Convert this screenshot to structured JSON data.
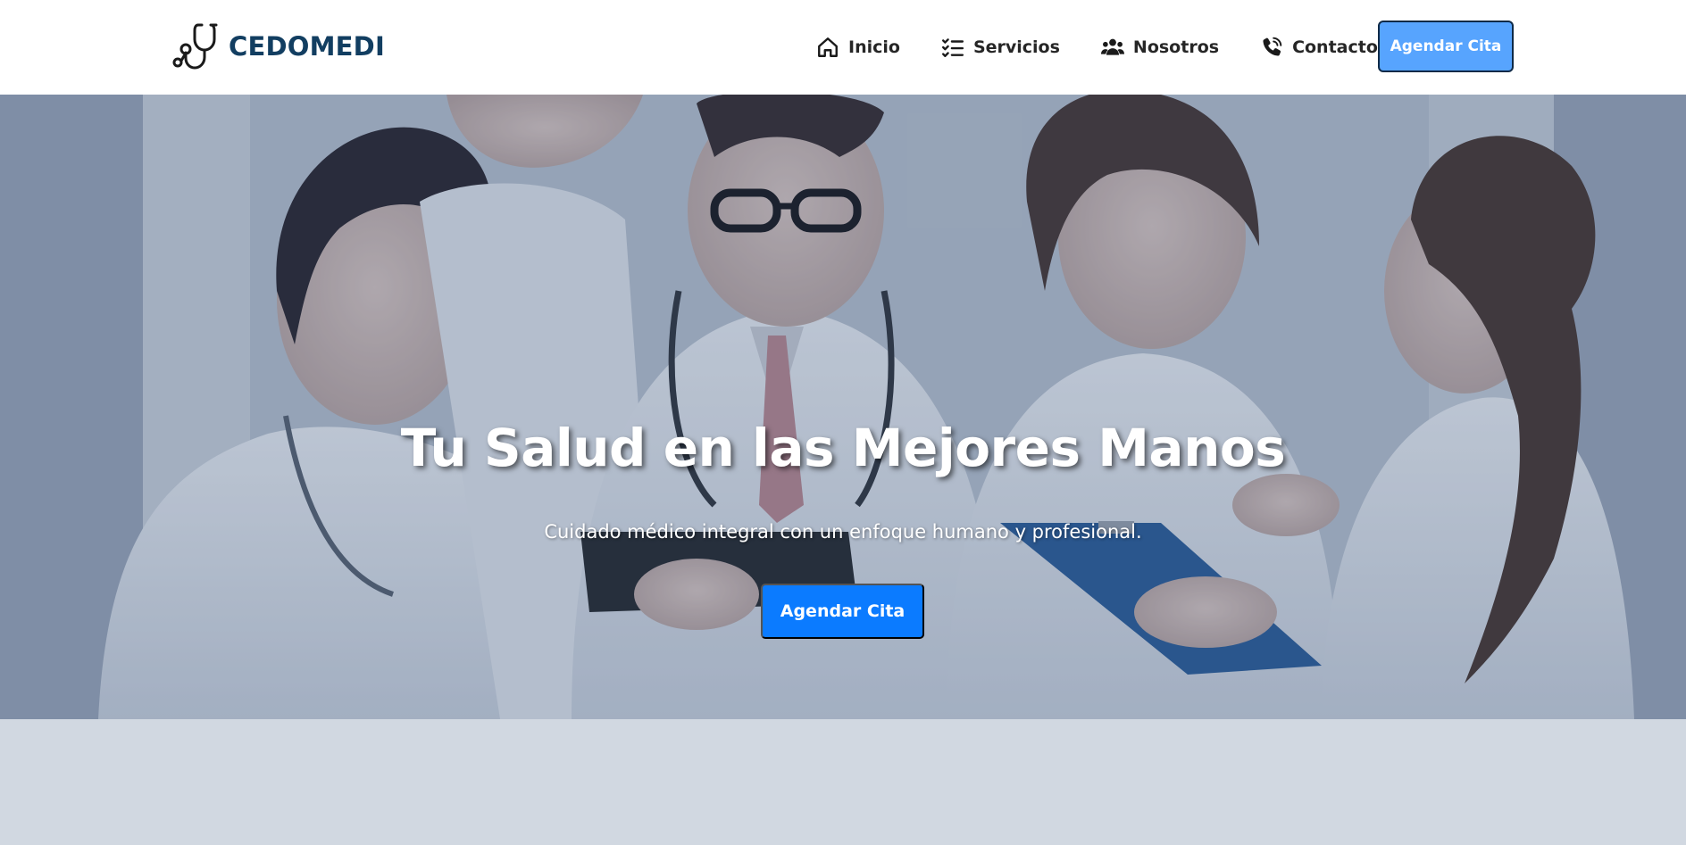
{
  "brand": {
    "name": "CEDOMEDI",
    "icon": "stethoscope-icon"
  },
  "nav": {
    "items": [
      {
        "label": "Inicio",
        "icon": "home-icon"
      },
      {
        "label": "Servicios",
        "icon": "list-check-icon"
      },
      {
        "label": "Nosotros",
        "icon": "users-icon"
      },
      {
        "label": "Contacto",
        "icon": "phone-icon"
      }
    ],
    "cta_label": "Agendar Cita"
  },
  "hero": {
    "title": "Tu Salud en las Mejores Manos",
    "subtitle": "Cuidado médico integral con un enfoque humano y profesional.",
    "cta_label": "Agendar Cita"
  },
  "colors": {
    "brand_text": "#123e61",
    "nav_cta_bg": "#57a4fe",
    "hero_cta_bg": "#0b7bff",
    "section_bg": "#d1d8e1"
  }
}
